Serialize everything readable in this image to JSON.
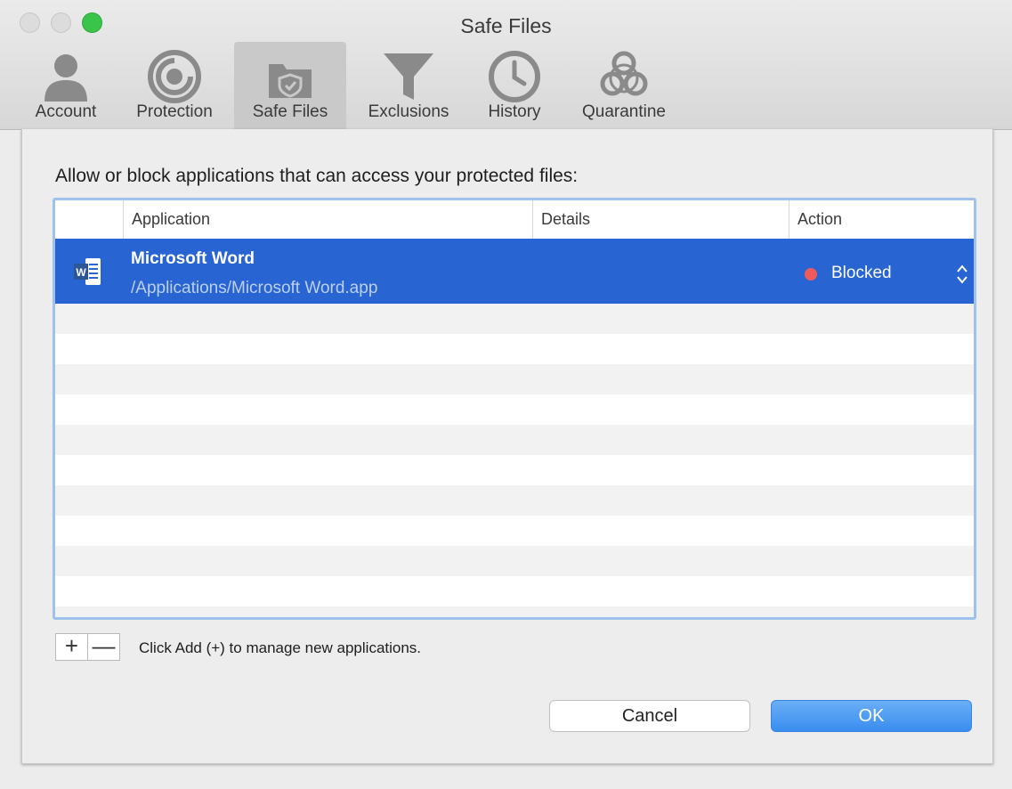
{
  "window": {
    "title": "Safe Files"
  },
  "tabs": [
    {
      "label": "Account",
      "icon": "person-icon"
    },
    {
      "label": "Protection",
      "icon": "protection-icon"
    },
    {
      "label": "Safe Files",
      "icon": "shield-folder-icon",
      "active": true
    },
    {
      "label": "Exclusions",
      "icon": "funnel-icon"
    },
    {
      "label": "History",
      "icon": "clock-icon"
    },
    {
      "label": "Quarantine",
      "icon": "biohazard-icon"
    }
  ],
  "main": {
    "heading": "Allow or block applications that can access your protected files:",
    "table": {
      "columns": [
        "Application",
        "Details",
        "Action"
      ],
      "rows": [
        {
          "name": "Microsoft Word",
          "path": "/Applications/Microsoft Word.app",
          "details": "",
          "action": "Blocked",
          "status_color": "#f05a5a",
          "icon": "word-icon"
        }
      ]
    },
    "add_symbol": "+",
    "remove_symbol": "—",
    "hint": "Click Add (+) to manage new applications."
  },
  "buttons": {
    "cancel": "Cancel",
    "ok": "OK"
  },
  "colors": {
    "selection": "#2864d2",
    "accent": "#3a8ef0",
    "blocked": "#f05a5a"
  }
}
